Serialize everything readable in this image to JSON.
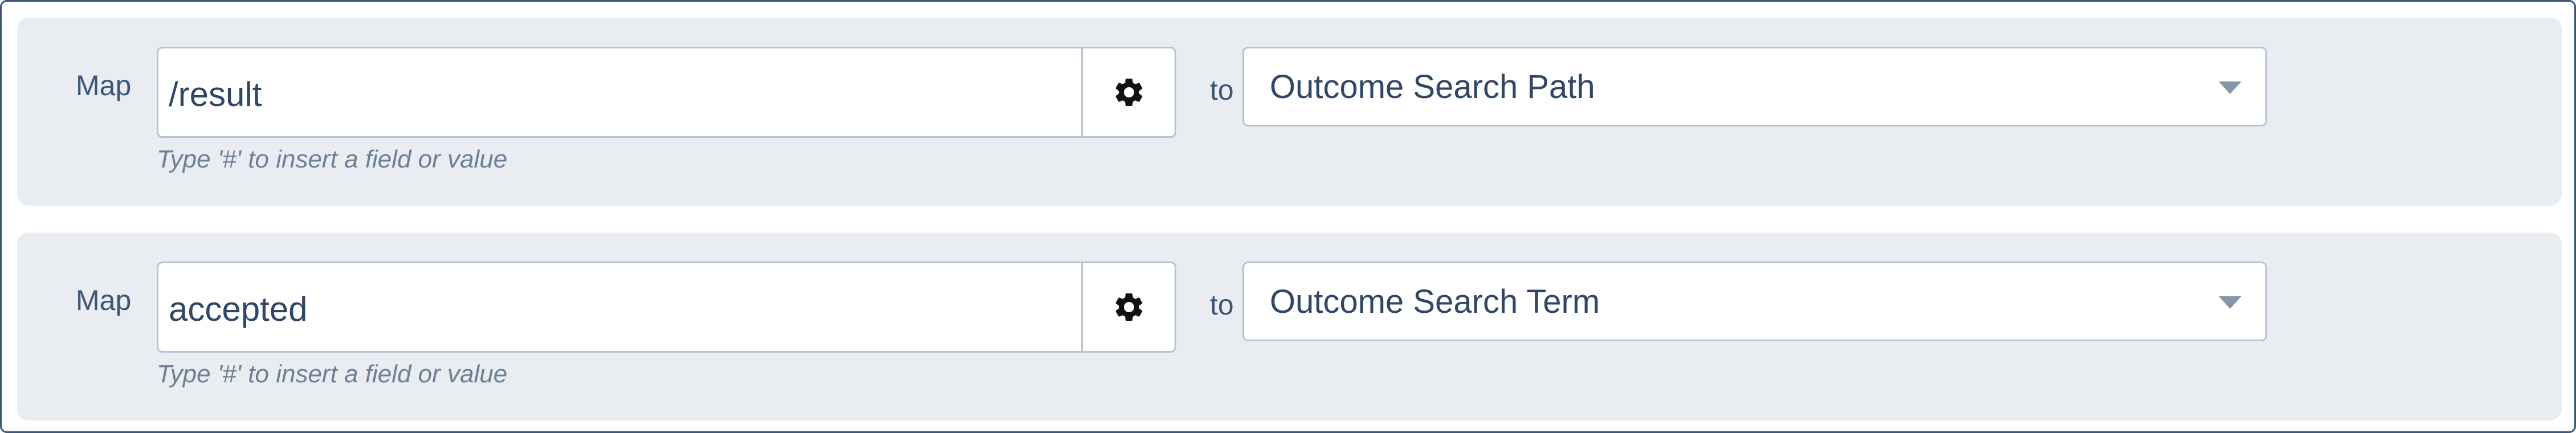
{
  "mappings": [
    {
      "map_label": "Map",
      "input_value": "/result",
      "hint": "Type '#' to insert a field or value",
      "to_label": "to",
      "target": "Outcome Search Path",
      "gear_icon": "gear-icon",
      "caret_icon": "chevron-down-icon"
    },
    {
      "map_label": "Map",
      "input_value": "accepted",
      "hint": "Type '#' to insert a field or value",
      "to_label": "to",
      "target": "Outcome Search Term",
      "gear_icon": "gear-icon",
      "caret_icon": "chevron-down-icon"
    }
  ],
  "colors": {
    "row_background": "#e9edf2",
    "border": "#b9c3cf",
    "text": "#2f4664",
    "label": "#3d5678",
    "hint": "#6c7f96"
  }
}
